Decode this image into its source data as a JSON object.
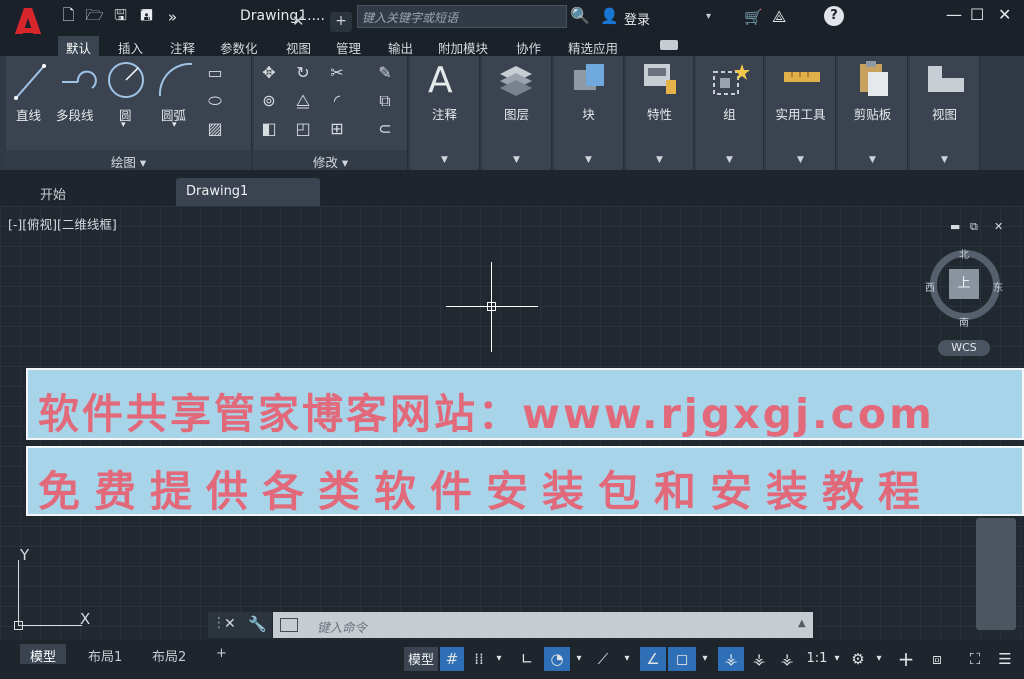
{
  "app": {
    "logo_letter": "A",
    "logo_color": "#d8262d"
  },
  "quick_access": {
    "icons": [
      "new-icon",
      "open-icon",
      "save-icon",
      "save-as-icon",
      "more-icon"
    ],
    "glyphs": [
      "🗋",
      "🗁",
      "🖫",
      "🖪",
      "»"
    ]
  },
  "title": {
    "drawing": "Drawing1....",
    "arrow": "▸"
  },
  "search": {
    "placeholder": "键入关键字或短语"
  },
  "account": {
    "login": "登录"
  },
  "ribbon_tabs": [
    {
      "label": "默认",
      "active": true
    },
    {
      "label": "插入"
    },
    {
      "label": "注释"
    },
    {
      "label": "参数化"
    },
    {
      "label": "视图"
    },
    {
      "label": "管理"
    },
    {
      "label": "输出"
    },
    {
      "label": "附加模块"
    },
    {
      "label": "协作"
    },
    {
      "label": "精选应用"
    }
  ],
  "draw_panel": {
    "title": "绘图",
    "tools": {
      "line": "直线",
      "polyline": "多段线",
      "circle": "圆",
      "arc": "圆弧"
    }
  },
  "modify_panel": {
    "title": "修改"
  },
  "big_panels": [
    {
      "label": "注释",
      "icon": "text-icon"
    },
    {
      "label": "图层",
      "icon": "layers-icon"
    },
    {
      "label": "块",
      "icon": "block-icon"
    },
    {
      "label": "特性",
      "icon": "properties-icon"
    },
    {
      "label": "组",
      "icon": "group-icon"
    },
    {
      "label": "实用工具",
      "icon": "measure-icon"
    },
    {
      "label": "剪贴板",
      "icon": "clipboard-icon"
    },
    {
      "label": "视图",
      "icon": "view-icon"
    }
  ],
  "doc_tabs": {
    "start": "开始",
    "drawing": "Drawing1"
  },
  "viewport": {
    "label": "[-][俯视][二维线框]"
  },
  "viewcube": {
    "top": "上",
    "north": "北",
    "south": "南",
    "east": "东",
    "west": "西",
    "wcs": "WCS"
  },
  "banner": {
    "line1": "软件共享管家博客网站：www.rjgxgj.com",
    "line2": "免费提供各类软件安装包和安装教程",
    "text_color": "#e2697a",
    "bg_color": "#a8d4ea"
  },
  "ucs": {
    "x": "X",
    "y": "Y"
  },
  "command": {
    "placeholder": "键入命令"
  },
  "layout_tabs": [
    {
      "label": "模型",
      "active": true
    },
    {
      "label": "布局1"
    },
    {
      "label": "布局2"
    }
  ],
  "status": {
    "model": "模型",
    "scale": "1:1"
  }
}
